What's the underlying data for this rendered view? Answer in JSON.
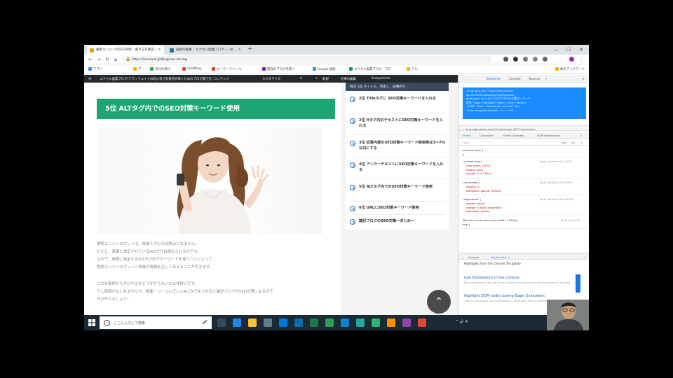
{
  "browser": {
    "tabs": [
      {
        "title": "検索エンジンのSEO対策、書き方を解説 | …",
        "active": true,
        "favicon_color": "#e8a020"
      },
      {
        "title": "投稿の編集 ‹ エクセル副業ブログ — W…",
        "active": false,
        "favicon_color": "#21759b"
      }
    ],
    "new_tab": "+",
    "window_controls": {
      "minimize": "—",
      "maximize": "☐",
      "close": "✕"
    },
    "nav": {
      "back": "←",
      "forward": "→",
      "reload": "↻",
      "home": "⌂"
    },
    "url": "https://hasunet.jp/blog/seo-alt-tag",
    "lock": "🔒",
    "bookmarks": [
      {
        "label": "アプリ",
        "color": "#4285f4"
      },
      {
        "label": "ブ",
        "color": "#f4b400"
      },
      {
        "label": "日付の日付",
        "color": "#34a853"
      },
      {
        "label": "ssnbBlog",
        "color": "#ea4335"
      },
      {
        "label": "キーワードツール",
        "color": "#db4437"
      },
      {
        "label": "最強のブログ作成ツ",
        "color": "#7b1fa2"
      },
      {
        "label": "Google 検索",
        "color": "#4285f4"
      },
      {
        "label": "エクセル副業ブログ・ブロ",
        "color": "#0f9d58"
      },
      {
        "label": "フル",
        "color": "#f4b400"
      },
      {
        "label": "他のブックマーク",
        "color": "#f4b400"
      }
    ]
  },
  "adminbar": {
    "items": [
      "エクセル副業ブログ(アフィリエイトは初心者が効果的の稼ぐためのブログ書き方) コンテンツ",
      "カスタマイズ",
      "0",
      "+",
      "新規",
      "記事の編集",
      "Autoptimize"
    ]
  },
  "article": {
    "heading": "5位 ALTタグ内でのSEO対策キーワード使用",
    "paragraphs": [
      "検索エンジンロボットは、画像そのものは読みとれません。",
      "ただし、画像に設定されているALTタグは読みとれるのです。",
      "なので、画像に設定するALTタグ内でキーワードを使うことによって、",
      "検索エンジンロボットに画像の情報を正しく伝えることができます。",
      "",
      "これを面倒がらずにやるかどうかやらないかは非常にです。",
      "少し面倒かもしれませんが、画像一つ一つに正しいALTタグを入れると雑記ブログのSEO対策になるので",
      "ぜひやりましょう！"
    ],
    "scroll_top": "⌃"
  },
  "toc": {
    "header": "目次   1位 タイトル、見出し、記事内で…",
    "items": [
      "2位 Titleタグに SEO対策キーワードを入れる",
      "2位 Hタグ内のテキストにSEO対策キーワードを入れる",
      "3位 記事内部のSEO対策キーワード使用率は3～7％以内にする",
      "4位 アンカーテキストにSEO対策キーワードを入れる",
      "5位 ALTタグ内でのSEO対策キーワード使用",
      "6位 URLにSEO対策キーワード使用",
      "雑記ブログのSEO対策～まとめ～"
    ]
  },
  "devtools": {
    "tabs": [
      "Elements",
      "Console",
      "Sources",
      "»"
    ],
    "code_lines": [
      "<img data-src=\"https://hasunet.jp/",
      "wp-content/uploads/2019/08/pexels-",
      "photo.jpg\" alt=\"ALT タグ内でのSEO対策キーワード",
      "使用\" class=\"lazyload\" width=\"1920\" height=",
      "\"1280\" class=\"aligncenter size-full\" src=",
      "\"data:image/gif;base64...\"> == $0",
      "</p>",
      "<p>…</p>"
    ],
    "breadcrumb": "…  img.aligncenter.size-full.wp-image-4077.lazyloaded",
    "subtabs": [
      "Styles",
      "Computed",
      "Event Listeners",
      "DOM Breakpoints",
      "»"
    ],
    "filter_placeholder": "Filter",
    "filter_options": [
      ":hov",
      ".cls",
      "+"
    ],
    "css_blocks": [
      {
        "selector": "element.style {",
        "lines": [
          "}"
        ],
        "src": ""
      },
      {
        "selector": ".content img {",
        "lines": [
          "max-width: 100%;",
          "height: auto;",
          "margin: 0 0 1.6em;"
        ],
        "src": "style.css?ver=5.2.4:120"
      },
      {
        "selector": ".lazyloaded {",
        "lines": [
          "opacity: 1;",
          "transition: opacity 300ms;"
        ],
        "src": "style.css?ver=5.2.4:2017"
      },
      {
        "selector": ".aligncenter {",
        "lines": [
          "display: block;",
          "margin: 0 auto !important;",
          "text-align: center;"
        ],
        "src": "style.css?ver=5.2.4:1053"
      },
      {
        "selector": "@media screen and (max-width: 1240px)",
        "lines": [
          "img {"
        ],
        "src": "style.css:1247"
      }
    ],
    "drawer": {
      "tabs": [
        "Console",
        "What's New ×"
      ],
      "heading": "Highlights from the Chrome 78 update",
      "items": [
        {
          "title": "Live Expressions in the Console",
          "desc": "Pin expressions to the top of the Console and watch their values update in real time."
        },
        {
          "title": "Highlight DOM nodes during Eager Evaluation",
          "desc": "Type an expression that evaluates to a DOM node and it's highlighted in the viewport."
        }
      ]
    }
  },
  "taskbar": {
    "search_placeholder": "ここに入力して検索",
    "mic": "🎤",
    "apps": [
      {
        "name": "task-view",
        "color": "#3a4a5a"
      },
      {
        "name": "edge",
        "color": "#1e88e5"
      },
      {
        "name": "explorer",
        "color": "#f9c13a"
      },
      {
        "name": "camera",
        "color": "#607d8b"
      },
      {
        "name": "mail",
        "color": "#0078d7"
      },
      {
        "name": "store",
        "color": "#0b6ea8"
      },
      {
        "name": "excel",
        "color": "#1d7a45"
      },
      {
        "name": "app-green",
        "color": "#2e9d57"
      },
      {
        "name": "photos",
        "color": "#0a84d0"
      },
      {
        "name": "app-teal",
        "color": "#23a89a"
      },
      {
        "name": "app-green2",
        "color": "#2bb673"
      },
      {
        "name": "app-orange",
        "color": "#ff8f00"
      },
      {
        "name": "app-purple",
        "color": "#8e44ad"
      },
      {
        "name": "chrome",
        "color": "#e94235"
      }
    ],
    "tray": "^  🔊  A"
  }
}
